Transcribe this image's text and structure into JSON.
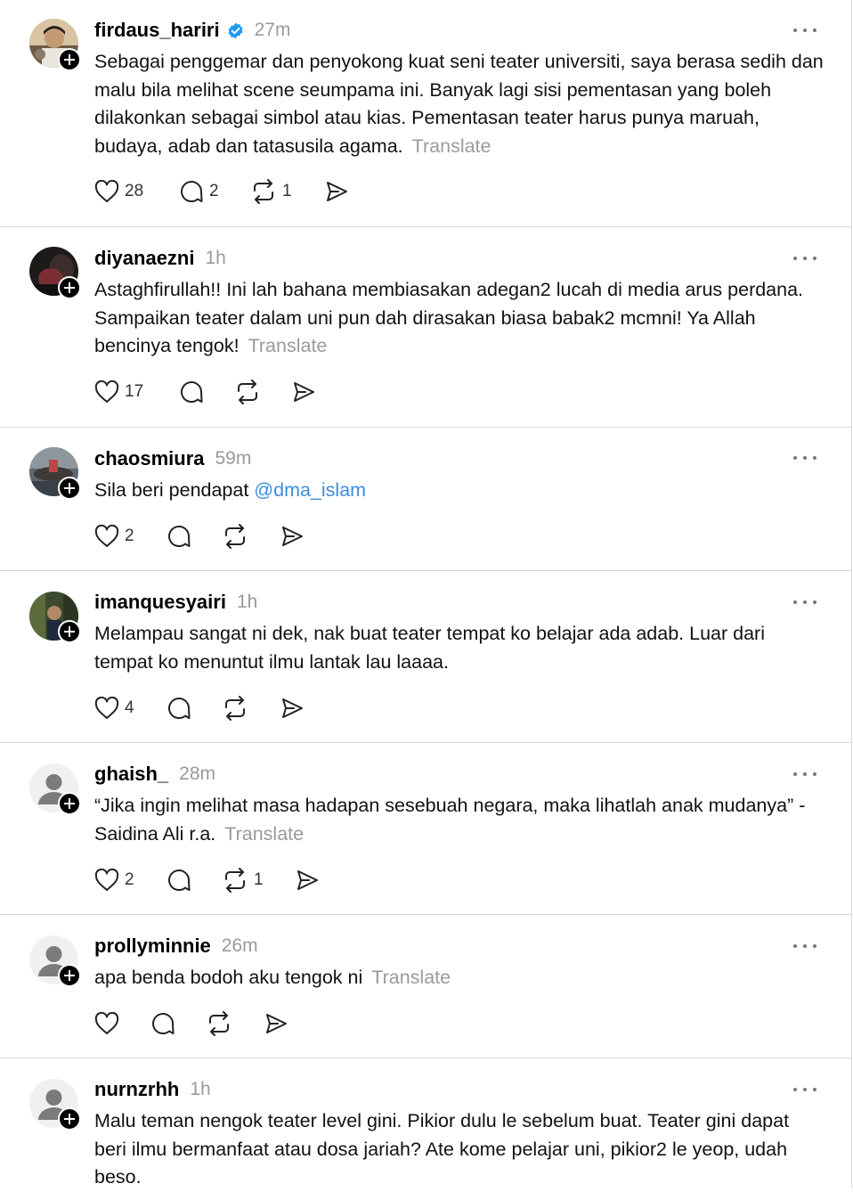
{
  "ui": {
    "translate_label": "Translate"
  },
  "posts": [
    {
      "username": "firdaus_hariri",
      "verified": true,
      "time": "27m",
      "text": "Sebagai penggemar dan penyokong kuat seni teater universiti, saya berasa sedih dan malu bila melihat scene seumpama ini. Banyak lagi sisi pementasan yang boleh dilakonkan sebagai simbol atau kias. Pementasan teater harus punya maruah, budaya, adab dan tatasusila agama.",
      "translate": "Translate",
      "likes": "28",
      "replies": "2",
      "reposts": "1",
      "avatar": "photo-person"
    },
    {
      "username": "diyanaezni",
      "verified": false,
      "time": "1h",
      "text": "Astaghfirullah!! Ini lah bahana membiasakan adegan2 lucah di media arus perdana. Sampaikan teater dalam uni pun dah dirasakan biasa babak2 mcmni! Ya Allah bencinya tengok!",
      "translate": "Translate",
      "likes": "17",
      "replies": "",
      "reposts": "",
      "avatar": "photo-dark"
    },
    {
      "username": "chaosmiura",
      "verified": false,
      "time": "59m",
      "text": "Sila beri pendapat ",
      "mention": "@dma_islam",
      "translate": "",
      "likes": "2",
      "replies": "",
      "reposts": "",
      "avatar": "photo-landscape"
    },
    {
      "username": "imanquesyairi",
      "verified": false,
      "time": "1h",
      "text": "Melampau sangat ni dek, nak buat teater tempat ko belajar ada adab. Luar dari tempat ko menuntut ilmu lantak lau laaaa.",
      "translate": "",
      "likes": "4",
      "replies": "",
      "reposts": "",
      "avatar": "photo-forest"
    },
    {
      "username": "ghaish_",
      "verified": false,
      "time": "28m",
      "text": "“Jika ingin melihat masa hadapan sesebuah negara, maka lihatlah anak mudanya” - Saidina Ali r.a.",
      "translate": "Translate",
      "likes": "2",
      "replies": "",
      "reposts": "1",
      "avatar": "default"
    },
    {
      "username": "prollyminnie",
      "verified": false,
      "time": "26m",
      "text": "apa benda bodoh aku tengok ni",
      "translate": "Translate",
      "likes": "",
      "replies": "",
      "reposts": "",
      "avatar": "default"
    },
    {
      "username": "nurnzrhh",
      "verified": false,
      "time": "1h",
      "text": "Malu teman nengok teater level gini. Pikior dulu le sebelum buat. Teater gini dapat beri ilmu bermanfaat atau dosa jariah? Ate kome pelajar uni, pikior2 le yeop, udah beso.",
      "translate": "",
      "likes": "",
      "replies": "",
      "reposts": "",
      "avatar": "default"
    }
  ],
  "icons": {
    "like": "heart-icon",
    "reply": "reply-icon",
    "repost": "repost-icon",
    "share": "send-icon",
    "more": "more-icon",
    "follow": "follow-plus-icon",
    "verified": "verified-badge-icon"
  },
  "colors": {
    "mention": "#3a8de0",
    "verified": "#1d9bf0",
    "muted": "#9a9a9a"
  }
}
